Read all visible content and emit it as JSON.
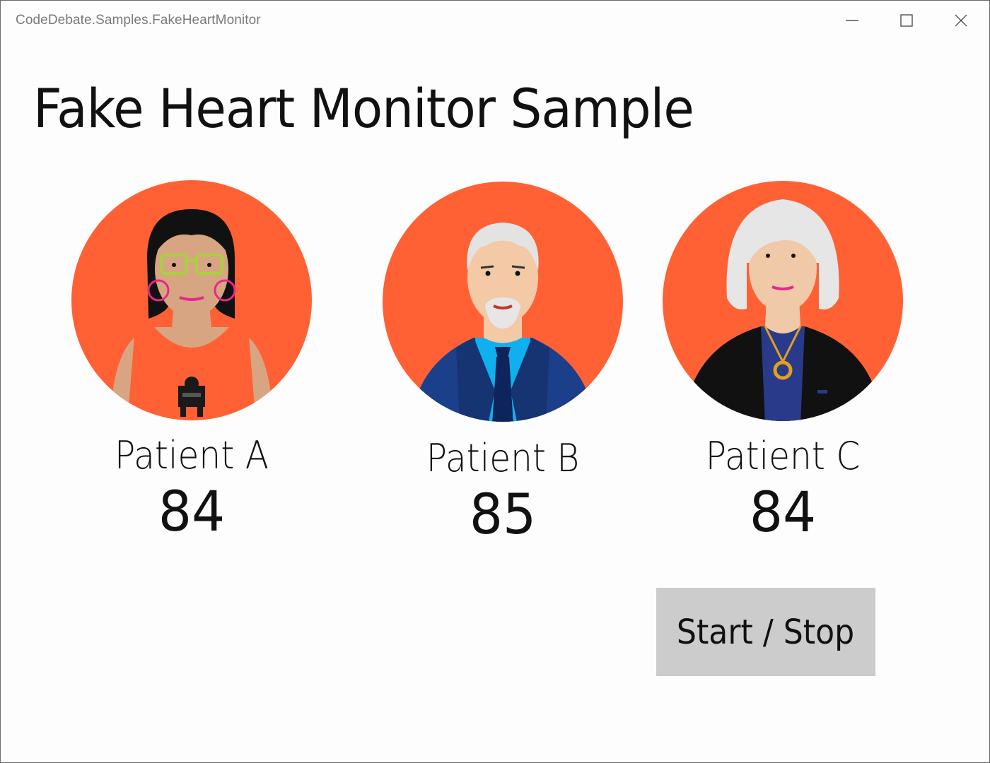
{
  "window": {
    "title": "CodeDebate.Samples.FakeHeartMonitor",
    "controls": {
      "minimize_icon": "minimize-icon",
      "maximize_icon": "maximize-icon",
      "close_icon": "close-icon"
    }
  },
  "page": {
    "title": "Fake Heart Monitor Sample"
  },
  "patients": [
    {
      "name": "Patient A",
      "heart_rate": "84",
      "avatar": "woman-glasses-avatar"
    },
    {
      "name": "Patient B",
      "heart_rate": "85",
      "avatar": "man-suit-avatar"
    },
    {
      "name": "Patient C",
      "heart_rate": "84",
      "avatar": "older-woman-avatar"
    }
  ],
  "controls": {
    "start_stop_label": "Start / Stop"
  },
  "colors": {
    "avatar_background": "#ff6135",
    "button_background": "#cccccc",
    "text": "#111111",
    "title_bar_text": "#7a7a7a"
  }
}
